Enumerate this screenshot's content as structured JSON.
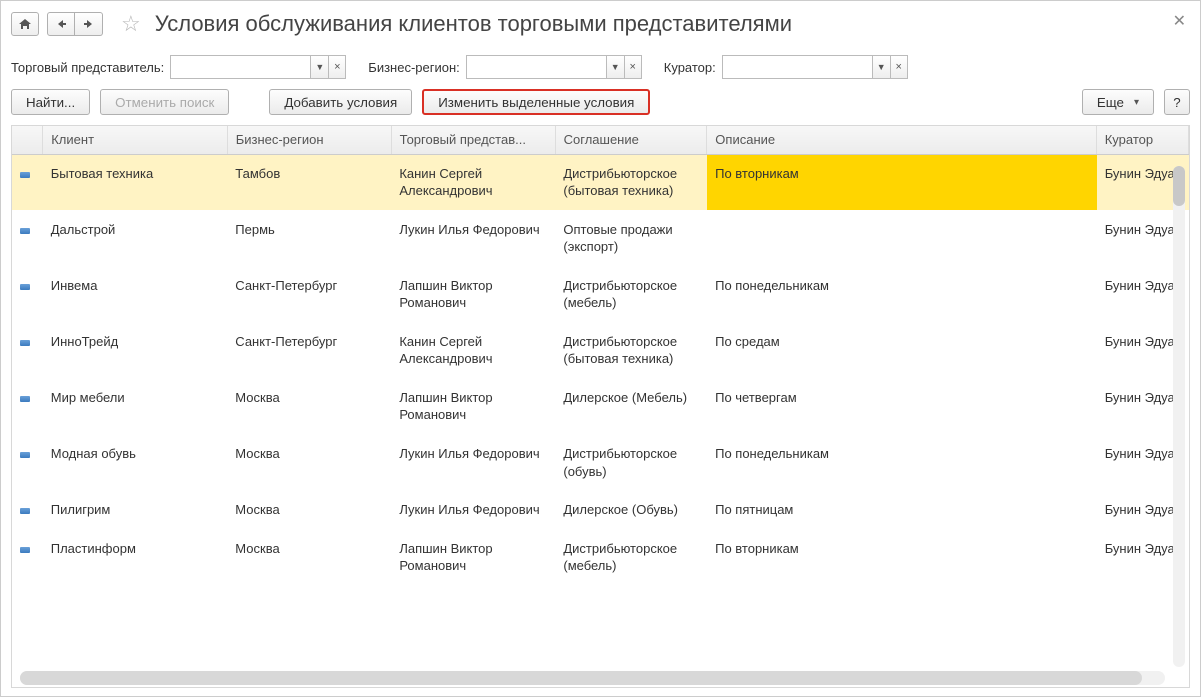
{
  "title": "Условия обслуживания клиентов торговыми представителями",
  "filters": {
    "rep_label": "Торговый представитель:",
    "region_label": "Бизнес-регион:",
    "curator_label": "Куратор:"
  },
  "toolbar": {
    "find": "Найти...",
    "cancel_search": "Отменить поиск",
    "add_conditions": "Добавить условия",
    "edit_selected": "Изменить выделенные условия",
    "more": "Еще",
    "help": "?"
  },
  "columns": {
    "client": "Клиент",
    "region": "Бизнес-регион",
    "rep": "Торговый представ...",
    "agreement": "Соглашение",
    "desc": "Описание",
    "curator": "Куратор"
  },
  "rows": [
    {
      "client": "Бытовая техника",
      "region": "Тамбов",
      "rep": "Канин Сергей Александрович",
      "agreement": "Дистрибьюторское (бытовая техника)",
      "desc": "По вторникам",
      "curator": "Бунин Эдуард Михайлович"
    },
    {
      "client": "Дальстрой",
      "region": "Пермь",
      "rep": "Лукин Илья Федорович",
      "agreement": "Оптовые продажи (экспорт)",
      "desc": "",
      "curator": "Бунин Эдуард Михайлович"
    },
    {
      "client": "Инвема",
      "region": "Санкт-Петербург",
      "rep": "Лапшин Виктор Романович",
      "agreement": "Дистрибьюторское (мебель)",
      "desc": "По понедельникам",
      "curator": "Бунин Эдуард Михайлович"
    },
    {
      "client": "ИнноТрейд",
      "region": "Санкт-Петербург",
      "rep": "Канин Сергей Александрович",
      "agreement": "Дистрибьюторское (бытовая техника)",
      "desc": "По средам",
      "curator": "Бунин Эдуард Михайлович"
    },
    {
      "client": "Мир мебели",
      "region": "Москва",
      "rep": "Лапшин Виктор Романович",
      "agreement": "Дилерское (Мебель)",
      "desc": "По четвергам",
      "curator": "Бунин Эдуард Михайлович"
    },
    {
      "client": "Модная обувь",
      "region": "Москва",
      "rep": "Лукин Илья Федорович",
      "agreement": "Дистрибьюторское (обувь)",
      "desc": "По понедельникам",
      "curator": "Бунин Эдуард Михайлович"
    },
    {
      "client": "Пилигрим",
      "region": "Москва",
      "rep": "Лукин Илья Федорович",
      "agreement": "Дилерское (Обувь)",
      "desc": "По пятницам",
      "curator": "Бунин Эдуард Михайлович"
    },
    {
      "client": "Пластинформ",
      "region": "Москва",
      "rep": "Лапшин Виктор Романович",
      "agreement": "Дистрибьюторское (мебель)",
      "desc": "По вторникам",
      "curator": "Бунин Эдуард Михайлович"
    }
  ]
}
